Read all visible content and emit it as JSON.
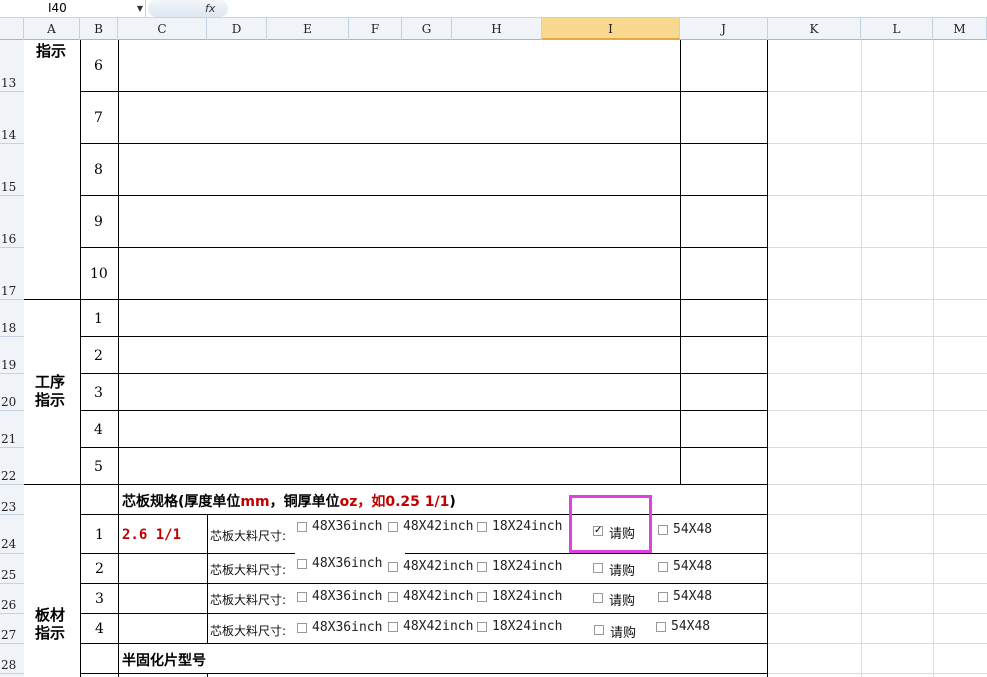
{
  "formula_bar": {
    "name_box": "I40",
    "fx": "fx"
  },
  "columns": [
    "A",
    "B",
    "C",
    "D",
    "E",
    "F",
    "G",
    "H",
    "I",
    "J",
    "K",
    "L",
    "M"
  ],
  "selected_column": "I",
  "rows": [
    "13",
    "14",
    "15",
    "16",
    "17",
    "18",
    "19",
    "20",
    "21",
    "22",
    "23",
    "24",
    "25",
    "26",
    "27",
    "28"
  ],
  "section1": {
    "label": "指示",
    "items": [
      "6",
      "7",
      "8",
      "9",
      "10"
    ]
  },
  "section2": {
    "label": "工序\n指示",
    "items": [
      "1",
      "2",
      "3",
      "4",
      "5"
    ]
  },
  "section3": {
    "label": "板材\n指示",
    "header": {
      "p1": "芯板规格(厚度单位",
      "mm": "mm",
      "p2": "，铜厚单位",
      "oz": "oz",
      "p3": "，如0.25 1/1",
      "p4": ")"
    },
    "rows": [
      {
        "no": "1",
        "spec": "2.6 1/1",
        "size_label": "芯板大料尺寸:",
        "o1": "48X36inch",
        "o2": "48X42inch",
        "o3": "18X24inch",
        "o4": "请购",
        "o4_checked": true,
        "o5": "54X48"
      },
      {
        "no": "2",
        "spec": "",
        "size_label": "芯板大料尺寸:",
        "o1": "48X36inch",
        "o2": "48X42inch",
        "o3": "18X24inch",
        "o4": "请购",
        "o4_checked": false,
        "o5": "54X48"
      },
      {
        "no": "3",
        "spec": "",
        "size_label": "芯板大料尺寸:",
        "o1": "48X36inch",
        "o2": "48X42inch",
        "o3": "18X24inch",
        "o4": "请购",
        "o4_checked": false,
        "o5": "54X48"
      },
      {
        "no": "4",
        "spec": "",
        "size_label": "芯板大料尺寸:",
        "o1": "48X36inch",
        "o2": "48X42inch",
        "o3": "18X24inch",
        "o4": "请购",
        "o4_checked": false,
        "o5": "54X48"
      }
    ],
    "prepreg_label": "半固化片型号"
  },
  "highlight_color": "#e040e0",
  "selected_col_color": "#f8d98f"
}
